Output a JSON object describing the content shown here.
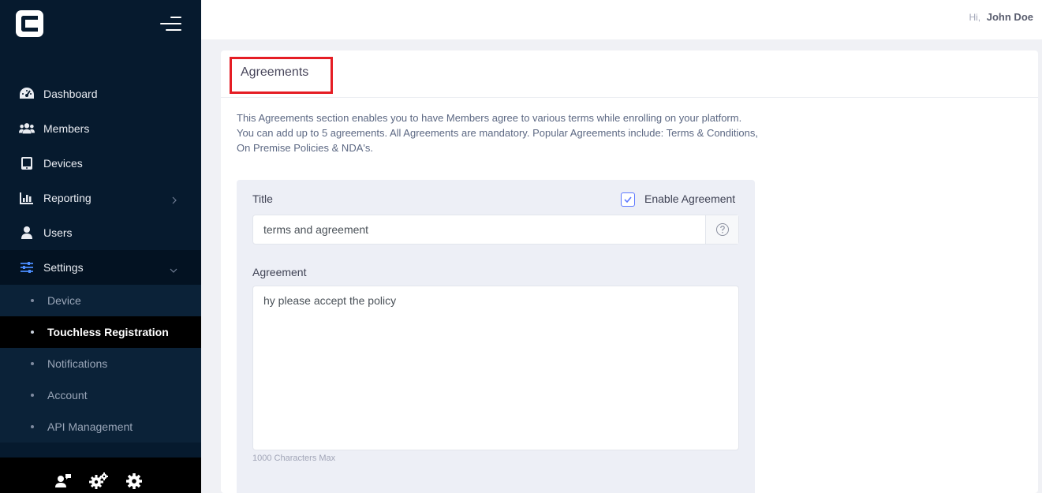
{
  "header": {
    "greeting": "Hi,",
    "user_name": "John Doe"
  },
  "sidebar": {
    "items": [
      {
        "label": "Dashboard",
        "icon": "gauge-icon"
      },
      {
        "label": "Members",
        "icon": "users-icon"
      },
      {
        "label": "Devices",
        "icon": "tablet-icon"
      },
      {
        "label": "Reporting",
        "icon": "bar-chart-icon"
      },
      {
        "label": "Users",
        "icon": "user-icon"
      },
      {
        "label": "Settings",
        "icon": "sliders-icon"
      }
    ],
    "settings_subitems": [
      {
        "label": "Device"
      },
      {
        "label": "Touchless Registration"
      },
      {
        "label": "Notifications"
      },
      {
        "label": "Account"
      },
      {
        "label": "API Management"
      }
    ],
    "footer_icons": [
      "user-chat-icon",
      "cogs-icon",
      "gear-icon"
    ]
  },
  "main": {
    "title": "Agreements",
    "description": "This Agreements section enables you to have Members agree to various terms while enrolling on your platform. You can add up to 5 agreements. All Agreements are mandatory. Popular Agreements include: Terms & Conditions, On Premise Policies & NDA's.",
    "agreement": {
      "title_label": "Title",
      "enable_label": "Enable Agreement",
      "enabled": true,
      "title_value": "terms and agreement",
      "agreement_label": "Agreement",
      "agreement_value": "hy please accept the policy",
      "hint": "1000 Characters Max"
    }
  },
  "colors": {
    "sidebar": "#061a2e",
    "accent": "#5d78ff",
    "highlight": "#e51d24"
  }
}
